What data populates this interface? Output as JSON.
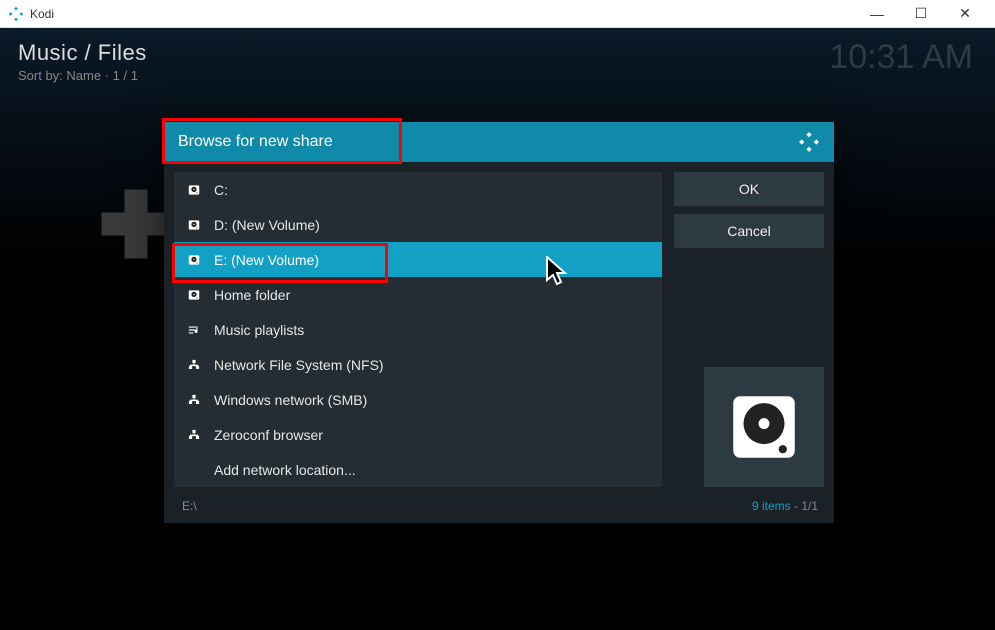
{
  "window": {
    "title": "Kodi"
  },
  "header": {
    "breadcrumb": "Music / Files",
    "sort_line": "Sort by: Name  ·  1 / 1",
    "clock": "10:31 AM"
  },
  "dialog": {
    "title": "Browse for new share",
    "items": [
      {
        "icon": "drive",
        "label": "C:"
      },
      {
        "icon": "drive",
        "label": "D: (New Volume)"
      },
      {
        "icon": "drive",
        "label": "E: (New Volume)",
        "selected": true
      },
      {
        "icon": "drive",
        "label": "Home folder"
      },
      {
        "icon": "playlist",
        "label": "Music playlists"
      },
      {
        "icon": "network",
        "label": "Network File System (NFS)"
      },
      {
        "icon": "network",
        "label": "Windows network (SMB)"
      },
      {
        "icon": "network",
        "label": "Zeroconf browser"
      },
      {
        "icon": "none",
        "label": "Add network location..."
      }
    ],
    "buttons": {
      "ok": "OK",
      "cancel": "Cancel"
    },
    "footer": {
      "path": "E:\\",
      "count": "9 items",
      "page": "1/1"
    }
  }
}
